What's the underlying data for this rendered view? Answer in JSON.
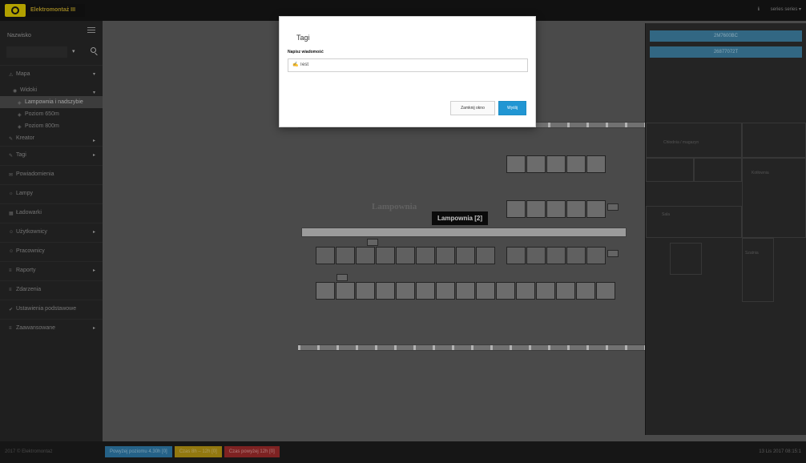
{
  "brand": {
    "logo_text": "Elektromontaż III"
  },
  "topbar": {
    "user_icon": "ℹ",
    "user_label": "series series ▾"
  },
  "sidebar": {
    "title": "Nazwisko",
    "search_go": "▾",
    "items": [
      {
        "icon": "⚠",
        "label": "Mapa",
        "chevron": "▾"
      },
      {
        "icon": "◉",
        "label": "Widoki",
        "chevron": "▾"
      },
      {
        "icon": "◈",
        "label": "Lampownia i nadszybie"
      },
      {
        "icon": "◈",
        "label": "Poziom 650m"
      },
      {
        "icon": "◈",
        "label": "Poziom 800m"
      },
      {
        "icon": "✎",
        "label": "Kreator",
        "chevron": "▸"
      },
      {
        "icon": "✎",
        "label": "Tagi",
        "chevron": "▸"
      },
      {
        "icon": "✉",
        "label": "Powiadomienia"
      },
      {
        "icon": "☼",
        "label": "Lampy"
      },
      {
        "icon": "▦",
        "label": "Ładowarki"
      },
      {
        "icon": "☺",
        "label": "Użytkownicy",
        "chevron": "▸"
      },
      {
        "icon": "☺",
        "label": "Pracownicy"
      },
      {
        "icon": "≡",
        "label": "Raporty",
        "chevron": "▸"
      },
      {
        "icon": "≡",
        "label": "Zdarzenia"
      },
      {
        "icon": "✔",
        "label": "Ustawienia podstawowe"
      },
      {
        "icon": "≡",
        "label": "Zaawansowane",
        "chevron": "▸"
      }
    ]
  },
  "map": {
    "label": "Lampownia",
    "tooltip": "Lampownia [2]"
  },
  "right_panel": {
    "buttons": [
      "2M7600BC",
      "26877072T"
    ],
    "labels": [
      "Chłodnia / magazyn",
      "Kotłownia",
      "Sala",
      "Szatnia"
    ]
  },
  "modal": {
    "title": "Tagi",
    "message_label": "Napisz wiadomość",
    "input_icon": "✍",
    "input_value": "Test",
    "close_label": "Zamknij okno",
    "send_label": "Wyślij"
  },
  "footer": {
    "left": "2017 © Elektromontaż",
    "legend": [
      {
        "label": "Powyżej poziomu 4.30h [0]",
        "color": "#2e78a6"
      },
      {
        "label": "Czas 8h – 12h [0]",
        "color": "#b39313"
      },
      {
        "label": "Czas powyżej 12h [0]",
        "color": "#9a2a2a"
      }
    ],
    "date": "13 Lis 2017 08:15:1"
  }
}
